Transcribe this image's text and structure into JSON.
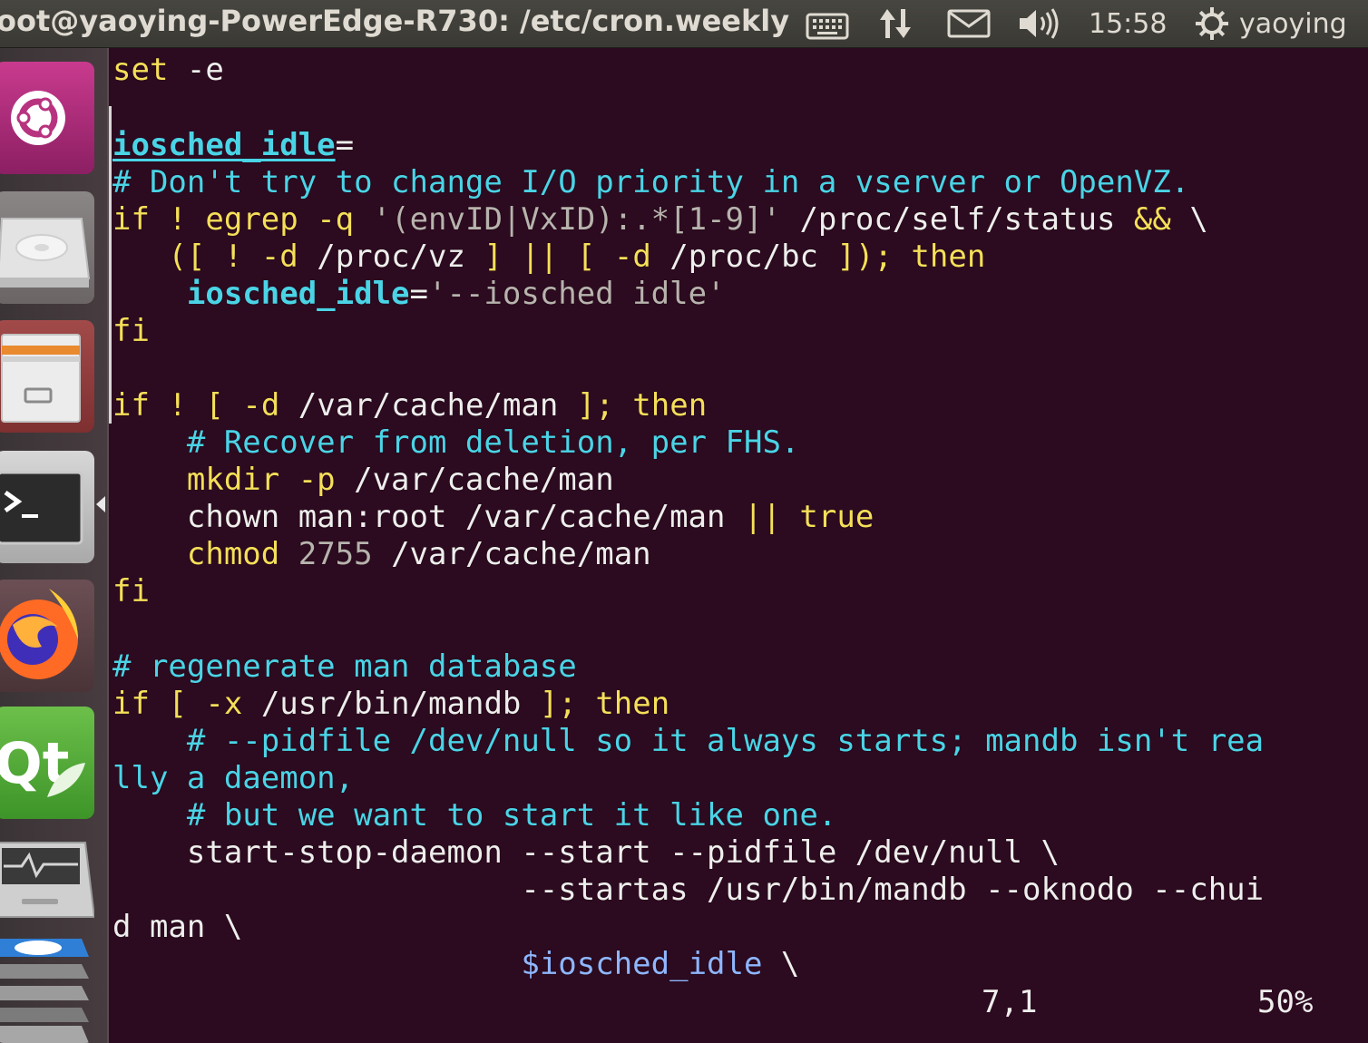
{
  "window": {
    "title": "oot@yaoying-PowerEdge-R730: /etc/cron.weekly"
  },
  "panel": {
    "icons": [
      "keyboard-icon",
      "network-transfer-icon",
      "mail-icon",
      "volume-icon",
      "power-gear-icon"
    ],
    "clock": "15:58",
    "user": "yaoying"
  },
  "launcher": {
    "items": [
      "ubuntu-dash-icon",
      "disk-drive-icon",
      "file-cabinet-icon",
      "terminal-icon",
      "firefox-icon",
      "qt-creator-icon",
      "system-monitor-icon",
      "stacked-apps-icon"
    ],
    "qt_label": "Qt"
  },
  "colors": {
    "terminal_bg": "#2c0a1f",
    "keyword_yellow": "#f5df59",
    "comment_cyan": "#4ad4e6",
    "string_gray": "#b7b3ad",
    "variable_blue": "#8fb6ff",
    "panel_bg": "#3c3b37"
  },
  "editor": {
    "lines": [
      {
        "segments": [
          {
            "t": "set",
            "c": "y"
          },
          {
            "t": " -e",
            "c": "w"
          }
        ]
      },
      {
        "segments": []
      },
      {
        "segments": [
          {
            "t": "iosched_idle",
            "c": "bb ul"
          },
          {
            "t": "=",
            "c": "w"
          }
        ]
      },
      {
        "segments": [
          {
            "t": "# Don't try to change I/O priority in a vserver or OpenVZ.",
            "c": "b"
          }
        ]
      },
      {
        "segments": [
          {
            "t": "if",
            "c": "y"
          },
          {
            "t": " ",
            "c": "w"
          },
          {
            "t": "!",
            "c": "y"
          },
          {
            "t": " egrep -q ",
            "c": "y"
          },
          {
            "t": "'(envID|VxID):.*[1-9]'",
            "c": "g"
          },
          {
            "t": " /proc/self/status ",
            "c": "w"
          },
          {
            "t": "&&",
            "c": "y"
          },
          {
            "t": " \\",
            "c": "w"
          }
        ]
      },
      {
        "segments": [
          {
            "t": "   ([",
            "c": "y"
          },
          {
            "t": " ",
            "c": "w"
          },
          {
            "t": "!",
            "c": "y"
          },
          {
            "t": " ",
            "c": "w"
          },
          {
            "t": "-d",
            "c": "y"
          },
          {
            "t": " /proc/vz ",
            "c": "w"
          },
          {
            "t": "]",
            "c": "y"
          },
          {
            "t": " ",
            "c": "w"
          },
          {
            "t": "||",
            "c": "y"
          },
          {
            "t": " ",
            "c": "w"
          },
          {
            "t": "[",
            "c": "y"
          },
          {
            "t": " ",
            "c": "w"
          },
          {
            "t": "-d",
            "c": "y"
          },
          {
            "t": " /proc/bc ",
            "c": "w"
          },
          {
            "t": "]);",
            "c": "y"
          },
          {
            "t": " ",
            "c": "w"
          },
          {
            "t": "then",
            "c": "y"
          }
        ]
      },
      {
        "segments": [
          {
            "t": "    ",
            "c": "w"
          },
          {
            "t": "iosched_idle",
            "c": "bb"
          },
          {
            "t": "=",
            "c": "w"
          },
          {
            "t": "'--iosched idle'",
            "c": "g"
          }
        ]
      },
      {
        "segments": [
          {
            "t": "fi",
            "c": "y"
          }
        ]
      },
      {
        "segments": []
      },
      {
        "segments": [
          {
            "t": "if",
            "c": "y"
          },
          {
            "t": " ",
            "c": "w"
          },
          {
            "t": "!",
            "c": "y"
          },
          {
            "t": " ",
            "c": "w"
          },
          {
            "t": "[",
            "c": "y"
          },
          {
            "t": " ",
            "c": "w"
          },
          {
            "t": "-d",
            "c": "y"
          },
          {
            "t": " /var/cache/man ",
            "c": "w"
          },
          {
            "t": "];",
            "c": "y"
          },
          {
            "t": " ",
            "c": "w"
          },
          {
            "t": "then",
            "c": "y"
          }
        ]
      },
      {
        "segments": [
          {
            "t": "    # Recover from deletion, per FHS.",
            "c": "b"
          }
        ]
      },
      {
        "segments": [
          {
            "t": "    mkdir -p",
            "c": "y"
          },
          {
            "t": " /var/cache/man",
            "c": "w"
          }
        ]
      },
      {
        "segments": [
          {
            "t": "    chown man:root /var/cache/man ",
            "c": "w"
          },
          {
            "t": "||",
            "c": "y"
          },
          {
            "t": " ",
            "c": "w"
          },
          {
            "t": "true",
            "c": "y"
          }
        ]
      },
      {
        "segments": [
          {
            "t": "    chmod",
            "c": "y"
          },
          {
            "t": " ",
            "c": "w"
          },
          {
            "t": "2755",
            "c": "g"
          },
          {
            "t": " /var/cache/man",
            "c": "w"
          }
        ]
      },
      {
        "segments": [
          {
            "t": "fi",
            "c": "y"
          }
        ]
      },
      {
        "segments": []
      },
      {
        "segments": [
          {
            "t": "# regenerate man database",
            "c": "b"
          }
        ]
      },
      {
        "segments": [
          {
            "t": "if",
            "c": "y"
          },
          {
            "t": " ",
            "c": "w"
          },
          {
            "t": "[",
            "c": "y"
          },
          {
            "t": " ",
            "c": "w"
          },
          {
            "t": "-x",
            "c": "y"
          },
          {
            "t": " /usr/bin/mandb ",
            "c": "w"
          },
          {
            "t": "];",
            "c": "y"
          },
          {
            "t": " ",
            "c": "w"
          },
          {
            "t": "then",
            "c": "y"
          }
        ]
      },
      {
        "segments": [
          {
            "t": "    # --pidfile /dev/null so it always starts; mandb isn't rea",
            "c": "b"
          }
        ]
      },
      {
        "segments": [
          {
            "t": "lly a daemon,",
            "c": "b"
          }
        ]
      },
      {
        "segments": [
          {
            "t": "    # but we want to start it like one.",
            "c": "b"
          }
        ]
      },
      {
        "segments": [
          {
            "t": "    start-stop-daemon --start --pidfile /dev/null \\",
            "c": "w"
          }
        ]
      },
      {
        "segments": [
          {
            "t": "                      --startas /usr/bin/mandb --oknodo --chui",
            "c": "w"
          }
        ]
      },
      {
        "segments": [
          {
            "t": "d man \\",
            "c": "w"
          }
        ]
      },
      {
        "segments": [
          {
            "t": "                      ",
            "c": "w"
          },
          {
            "t": "$iosched_idle",
            "c": "p"
          },
          {
            "t": " \\",
            "c": "w"
          }
        ]
      }
    ],
    "status": {
      "position": "7,1",
      "percent": "50%"
    }
  }
}
